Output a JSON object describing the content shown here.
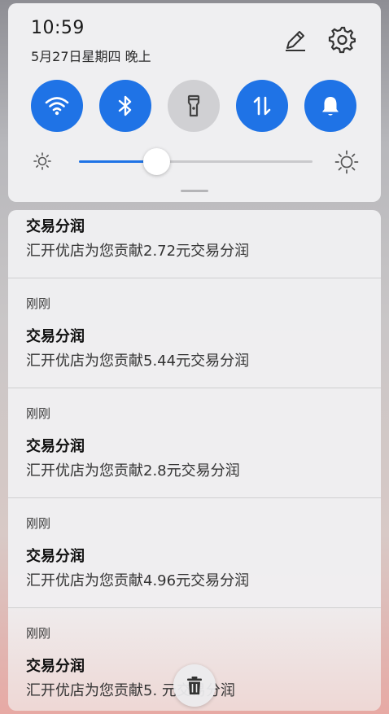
{
  "status": {
    "time": "10:59",
    "date": "5月27日星期四 晚上"
  },
  "quick_settings": {
    "tiles": [
      {
        "name": "wifi",
        "icon": "wifi-icon",
        "state": "on"
      },
      {
        "name": "bluetooth",
        "icon": "bluetooth-icon",
        "state": "on"
      },
      {
        "name": "flashlight",
        "icon": "flashlight-icon",
        "state": "off"
      },
      {
        "name": "mobile-data",
        "icon": "data-transfer-icon",
        "state": "on"
      },
      {
        "name": "sound",
        "icon": "bell-icon",
        "state": "on"
      }
    ],
    "brightness": 0.33,
    "accent_color": "#1f73e6"
  },
  "notifications": [
    {
      "time": "",
      "title": "交易分润",
      "body": "汇开优店为您贡献2.72元交易分润"
    },
    {
      "time": "刚刚",
      "title": "交易分润",
      "body": "汇开优店为您贡献5.44元交易分润"
    },
    {
      "time": "刚刚",
      "title": "交易分润",
      "body": "汇开优店为您贡献2.8元交易分润"
    },
    {
      "time": "刚刚",
      "title": "交易分润",
      "body": "汇开优店为您贡献4.96元交易分润"
    },
    {
      "time": "刚刚",
      "title": "交易分润",
      "body": "汇开优店为您贡献5.  元交易分润"
    }
  ],
  "clear_all": {
    "icon": "trash-icon"
  }
}
